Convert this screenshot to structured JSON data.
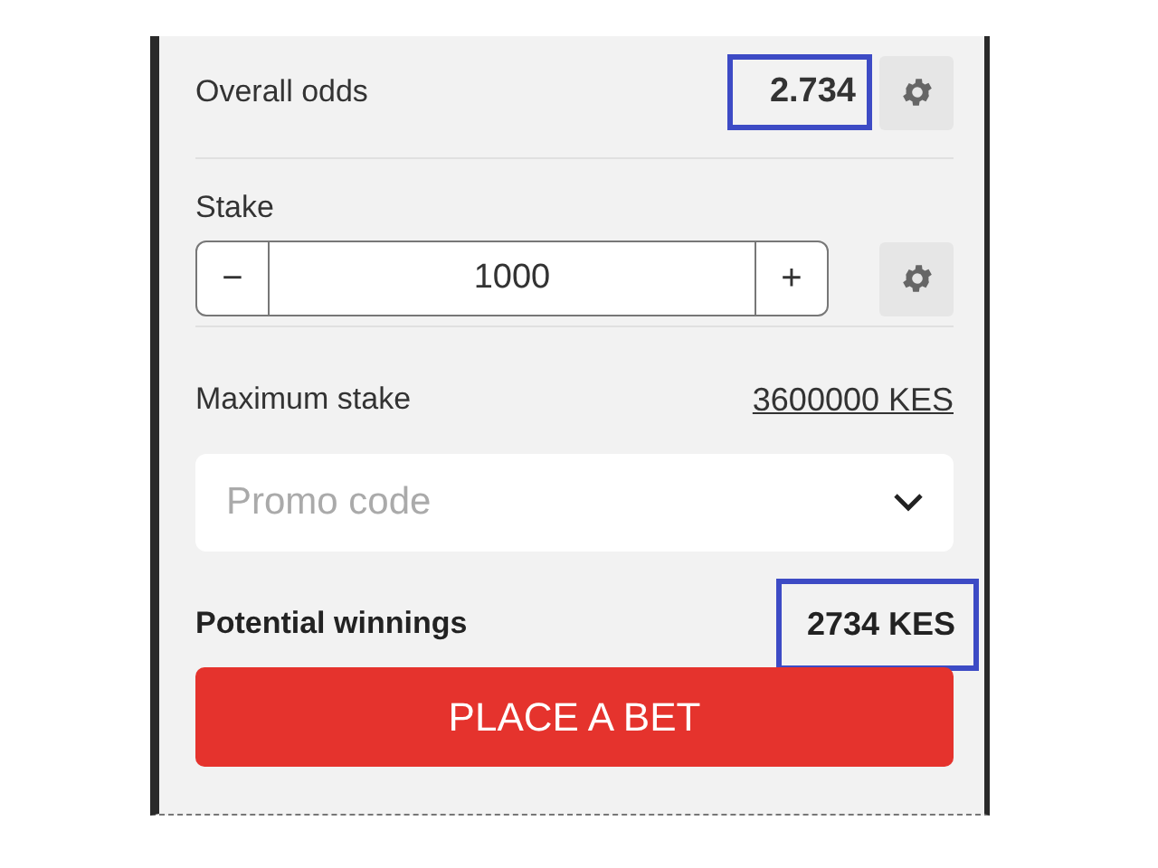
{
  "odds": {
    "label": "Overall odds",
    "value": "2.734",
    "highlighted": true
  },
  "stake": {
    "label": "Stake",
    "minus": "−",
    "value": "1000",
    "plus": "+"
  },
  "max_stake": {
    "label": "Maximum stake",
    "value": "3600000 KES"
  },
  "promo": {
    "placeholder": "Promo code"
  },
  "winnings": {
    "label": "Potential winnings",
    "value": "2734 KES",
    "highlighted": true
  },
  "button": "PLACE A BET"
}
